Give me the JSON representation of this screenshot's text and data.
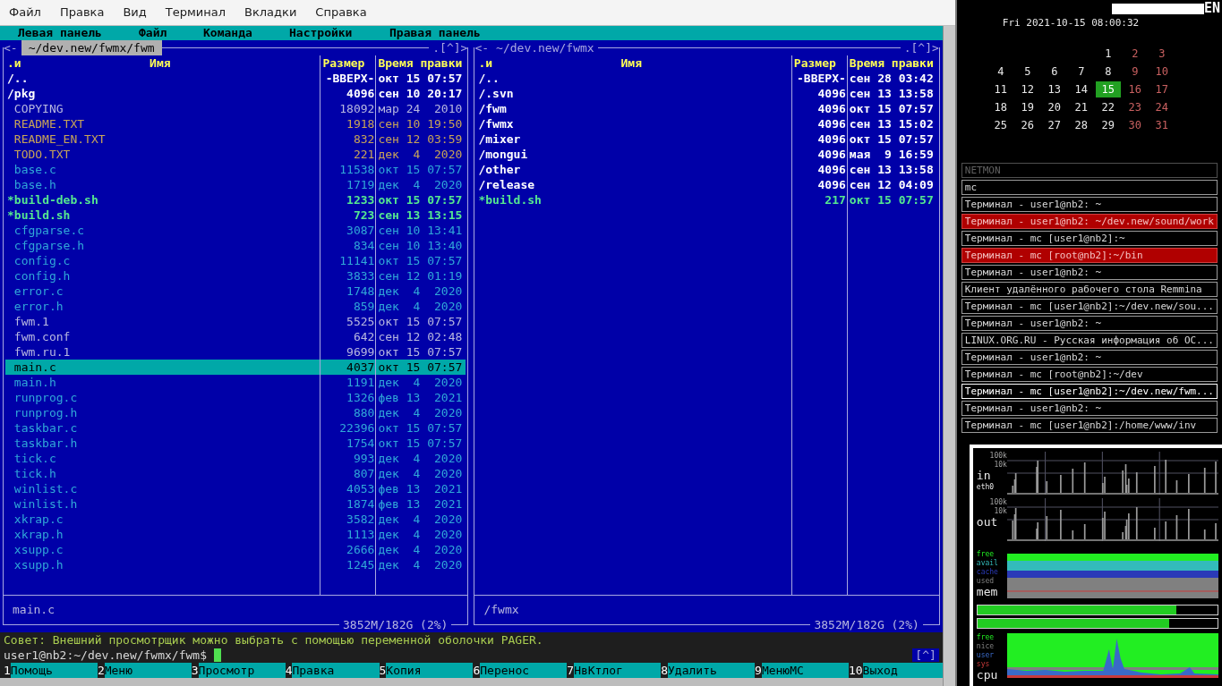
{
  "terminal_menu": [
    "Файл",
    "Правка",
    "Вид",
    "Терминал",
    "Вкладки",
    "Справка"
  ],
  "mc_menu": [
    "Левая панель",
    "Файл",
    "Команда",
    "Настройки",
    "Правая панель"
  ],
  "left_panel": {
    "active": true,
    "back": "<-",
    "path": "~/dev.new/fwmx/fwm",
    "hotlist": ".[^]>",
    "columns": [
      ".и",
      "Имя",
      "Размер",
      "Время правки"
    ],
    "rows": [
      {
        "name": "/..",
        "size": "-ВВЕРХ-",
        "date": "окт 15 07:57",
        "kind": "updir",
        "selected": false
      },
      {
        "name": "/pkg",
        "size": "4096",
        "date": "сен 10 20:17",
        "kind": "dir",
        "selected": false
      },
      {
        "name": "COPYING",
        "size": "18092",
        "date": "мар 24  2010",
        "kind": "other",
        "selected": false
      },
      {
        "name": "README.TXT",
        "size": "1918",
        "date": "сен 10 19:50",
        "kind": "doc",
        "selected": false
      },
      {
        "name": "README_EN.TXT",
        "size": "832",
        "date": "сен 12 03:59",
        "kind": "doc",
        "selected": false
      },
      {
        "name": "TODO.TXT",
        "size": "221",
        "date": "дек  4  2020",
        "kind": "doc",
        "selected": false
      },
      {
        "name": "base.c",
        "size": "11538",
        "date": "окт 15 07:57",
        "kind": "source",
        "selected": false
      },
      {
        "name": "base.h",
        "size": "1719",
        "date": "дек  4  2020",
        "kind": "source",
        "selected": false
      },
      {
        "name": "*build-deb.sh",
        "size": "1233",
        "date": "окт 15 07:57",
        "kind": "exec",
        "selected": false
      },
      {
        "name": "*build.sh",
        "size": "723",
        "date": "сен 13 13:15",
        "kind": "exec",
        "selected": false
      },
      {
        "name": "cfgparse.c",
        "size": "3087",
        "date": "сен 10 13:41",
        "kind": "source",
        "selected": false
      },
      {
        "name": "cfgparse.h",
        "size": "834",
        "date": "сен 10 13:40",
        "kind": "source",
        "selected": false
      },
      {
        "name": "config.c",
        "size": "11141",
        "date": "окт 15 07:57",
        "kind": "source",
        "selected": false
      },
      {
        "name": "config.h",
        "size": "3833",
        "date": "сен 12 01:19",
        "kind": "source",
        "selected": false
      },
      {
        "name": "error.c",
        "size": "1748",
        "date": "дек  4  2020",
        "kind": "source",
        "selected": false
      },
      {
        "name": "error.h",
        "size": "859",
        "date": "дек  4  2020",
        "kind": "source",
        "selected": false
      },
      {
        "name": "fwm.1",
        "size": "5525",
        "date": "окт 15 07:57",
        "kind": "other",
        "selected": false
      },
      {
        "name": "fwm.conf",
        "size": "642",
        "date": "сен 12 02:48",
        "kind": "other",
        "selected": false
      },
      {
        "name": "fwm.ru.1",
        "size": "9699",
        "date": "окт 15 07:57",
        "kind": "other",
        "selected": false
      },
      {
        "name": "main.c",
        "size": "4037",
        "date": "окт 15 07:57",
        "kind": "source",
        "selected": true
      },
      {
        "name": "main.h",
        "size": "1191",
        "date": "дек  4  2020",
        "kind": "source",
        "selected": false
      },
      {
        "name": "runprog.c",
        "size": "1326",
        "date": "фев 13  2021",
        "kind": "source",
        "selected": false
      },
      {
        "name": "runprog.h",
        "size": "880",
        "date": "дек  4  2020",
        "kind": "source",
        "selected": false
      },
      {
        "name": "taskbar.c",
        "size": "22396",
        "date": "окт 15 07:57",
        "kind": "source",
        "selected": false
      },
      {
        "name": "taskbar.h",
        "size": "1754",
        "date": "окт 15 07:57",
        "kind": "source",
        "selected": false
      },
      {
        "name": "tick.c",
        "size": "993",
        "date": "дек  4  2020",
        "kind": "source",
        "selected": false
      },
      {
        "name": "tick.h",
        "size": "807",
        "date": "дек  4  2020",
        "kind": "source",
        "selected": false
      },
      {
        "name": "winlist.c",
        "size": "4053",
        "date": "фев 13  2021",
        "kind": "source",
        "selected": false
      },
      {
        "name": "winlist.h",
        "size": "1874",
        "date": "фев 13  2021",
        "kind": "source",
        "selected": false
      },
      {
        "name": "xkrap.c",
        "size": "3582",
        "date": "дек  4  2020",
        "kind": "source",
        "selected": false
      },
      {
        "name": "xkrap.h",
        "size": "1113",
        "date": "дек  4  2020",
        "kind": "source",
        "selected": false
      },
      {
        "name": "xsupp.c",
        "size": "2666",
        "date": "дек  4  2020",
        "kind": "source",
        "selected": false
      },
      {
        "name": "xsupp.h",
        "size": "1245",
        "date": "дек  4  2020",
        "kind": "source",
        "selected": false
      }
    ],
    "status": "main.c",
    "free": "3852M/182G (2%)"
  },
  "right_panel": {
    "active": false,
    "back": "<-",
    "path": "~/dev.new/fwmx",
    "hotlist": ".[^]>",
    "columns": [
      ".и",
      "Имя",
      "Размер",
      "Время правки"
    ],
    "rows": [
      {
        "name": "/..",
        "size": "-ВВЕРХ-",
        "date": "сен 28 03:42",
        "kind": "updir",
        "selected": false
      },
      {
        "name": "/.svn",
        "size": "4096",
        "date": "сен 13 13:58",
        "kind": "dir",
        "selected": false
      },
      {
        "name": "/fwm",
        "size": "4096",
        "date": "окт 15 07:57",
        "kind": "dir",
        "selected": false
      },
      {
        "name": "/fwmx",
        "size": "4096",
        "date": "сен 13 15:02",
        "kind": "dir",
        "selected": false
      },
      {
        "name": "/mixer",
        "size": "4096",
        "date": "окт 15 07:57",
        "kind": "dir",
        "selected": false
      },
      {
        "name": "/mongui",
        "size": "4096",
        "date": "мая  9 16:59",
        "kind": "dir",
        "selected": false
      },
      {
        "name": "/other",
        "size": "4096",
        "date": "сен 13 13:58",
        "kind": "dir",
        "selected": false
      },
      {
        "name": "/release",
        "size": "4096",
        "date": "сен 12 04:09",
        "kind": "dir",
        "selected": false
      },
      {
        "name": "*build.sh",
        "size": "217",
        "date": "окт 15 07:57",
        "kind": "exec",
        "selected": false
      }
    ],
    "status": "/fwmx",
    "free": "3852M/182G (2%)"
  },
  "hint": "Совет: Внешний просмотрщик можно выбрать с помощью переменной оболочки PAGER.",
  "prompt": "user1@nb2:~/dev.new/fwmx/fwm$",
  "history_button": "[^]",
  "function_keys": [
    {
      "number": "1",
      "label": "Помощь"
    },
    {
      "number": "2",
      "label": "Меню"
    },
    {
      "number": "3",
      "label": "Просмотр"
    },
    {
      "number": "4",
      "label": "Правка"
    },
    {
      "number": "5",
      "label": "Копия"
    },
    {
      "number": "6",
      "label": "Перенос"
    },
    {
      "number": "7",
      "label": "НвКтлог"
    },
    {
      "number": "8",
      "label": "Удалить"
    },
    {
      "number": "9",
      "label": "МенюМС"
    },
    {
      "number": "10",
      "label": "Выход"
    }
  ],
  "sidebar": {
    "layout": "EN",
    "clock": "Fri 2021-10-15 08:00:32",
    "calendar": [
      [
        {
          "day": "1",
          "weekend": false,
          "selected": false
        },
        {
          "day": "2",
          "weekend": true,
          "selected": false
        },
        {
          "day": "3",
          "weekend": true,
          "selected": false
        }
      ],
      [
        {
          "day": "4",
          "weekend": false,
          "selected": false
        },
        {
          "day": "5",
          "weekend": false,
          "selected": false
        },
        {
          "day": "6",
          "weekend": false,
          "selected": false
        },
        {
          "day": "7",
          "weekend": false,
          "selected": false
        },
        {
          "day": "8",
          "weekend": false,
          "selected": false
        },
        {
          "day": "9",
          "weekend": true,
          "selected": false
        },
        {
          "day": "10",
          "weekend": true,
          "selected": false
        }
      ],
      [
        {
          "day": "11",
          "weekend": false,
          "selected": false
        },
        {
          "day": "12",
          "weekend": false,
          "selected": false
        },
        {
          "day": "13",
          "weekend": false,
          "selected": false
        },
        {
          "day": "14",
          "weekend": false,
          "selected": false
        },
        {
          "day": "15",
          "weekend": false,
          "selected": true
        },
        {
          "day": "16",
          "weekend": true,
          "selected": false
        },
        {
          "day": "17",
          "weekend": true,
          "selected": false
        }
      ],
      [
        {
          "day": "18",
          "weekend": false,
          "selected": false
        },
        {
          "day": "19",
          "weekend": false,
          "selected": false
        },
        {
          "day": "20",
          "weekend": false,
          "selected": false
        },
        {
          "day": "21",
          "weekend": false,
          "selected": false
        },
        {
          "day": "22",
          "weekend": false,
          "selected": false
        },
        {
          "day": "23",
          "weekend": true,
          "selected": false
        },
        {
          "day": "24",
          "weekend": true,
          "selected": false
        }
      ],
      [
        {
          "day": "25",
          "weekend": false,
          "selected": false
        },
        {
          "day": "26",
          "weekend": false,
          "selected": false
        },
        {
          "day": "27",
          "weekend": false,
          "selected": false
        },
        {
          "day": "28",
          "weekend": false,
          "selected": false
        },
        {
          "day": "29",
          "weekend": false,
          "selected": false
        },
        {
          "day": "30",
          "weekend": true,
          "selected": false
        },
        {
          "day": "31",
          "weekend": true,
          "selected": false
        }
      ]
    ],
    "windows": [
      {
        "title": "NETMON",
        "kind": "minimized",
        "selected": false
      },
      {
        "title": "mc",
        "kind": "normal",
        "selected": false
      },
      {
        "title": "Терминал - user1@nb2: ~",
        "kind": "normal",
        "selected": false
      },
      {
        "title": "Терминал - user1@nb2: ~/dev.new/sound/work",
        "kind": "urgent",
        "selected": false
      },
      {
        "title": "Терминал - mc [user1@nb2]:~",
        "kind": "normal",
        "selected": false
      },
      {
        "title": "Терминал - mc [root@nb2]:~/bin",
        "kind": "urgent",
        "selected": false
      },
      {
        "title": "Терминал - user1@nb2: ~",
        "kind": "normal",
        "selected": false
      },
      {
        "title": "Клиент удалённого рабочего стола Remmina",
        "kind": "normal",
        "selected": false
      },
      {
        "title": "Терминал - mc [user1@nb2]:~/dev.new/sou...",
        "kind": "normal",
        "selected": false
      },
      {
        "title": "Терминал - user1@nb2: ~",
        "kind": "normal",
        "selected": false
      },
      {
        "title": "LINUX.ORG.RU - Русская информация об ОС...",
        "kind": "normal",
        "selected": false
      },
      {
        "title": "Терминал - user1@nb2: ~",
        "kind": "normal",
        "selected": false
      },
      {
        "title": "Терминал - mc [root@nb2]:~/dev",
        "kind": "normal",
        "selected": false
      },
      {
        "title": "Терминал - mc [user1@nb2]:~/dev.new/fwm...",
        "kind": "normal",
        "selected": true
      },
      {
        "title": "Терминал - user1@nb2: ~",
        "kind": "normal",
        "selected": false
      },
      {
        "title": "Терминал - mc [user1@nb2]:/home/www/inv",
        "kind": "normal",
        "selected": false
      }
    ]
  },
  "monitor": {
    "net": [
      {
        "ticks": [
          "100k",
          "10k"
        ],
        "label": "in",
        "iface": "eth0"
      },
      {
        "ticks": [
          "100k",
          "10k"
        ],
        "label": "out"
      }
    ],
    "memory": {
      "label": "mem",
      "legend": [
        {
          "label": "free",
          "color": "#22ee22"
        },
        {
          "label": "avail",
          "color": "#33bbbb"
        },
        {
          "label": "cache",
          "color": "#2a3ab8"
        },
        {
          "label": "used",
          "color": "#808080"
        }
      ]
    },
    "meters": [
      {
        "level": 0.83
      },
      {
        "level": 0.8
      }
    ],
    "cpu": {
      "label": "cpu",
      "legend": [
        {
          "label": "free",
          "color": "#22ee22"
        },
        {
          "label": "nice",
          "color": "#808080"
        },
        {
          "label": "user",
          "color": "#3a6ac8"
        },
        {
          "label": "sys",
          "color": "#c83a3a"
        }
      ]
    }
  }
}
